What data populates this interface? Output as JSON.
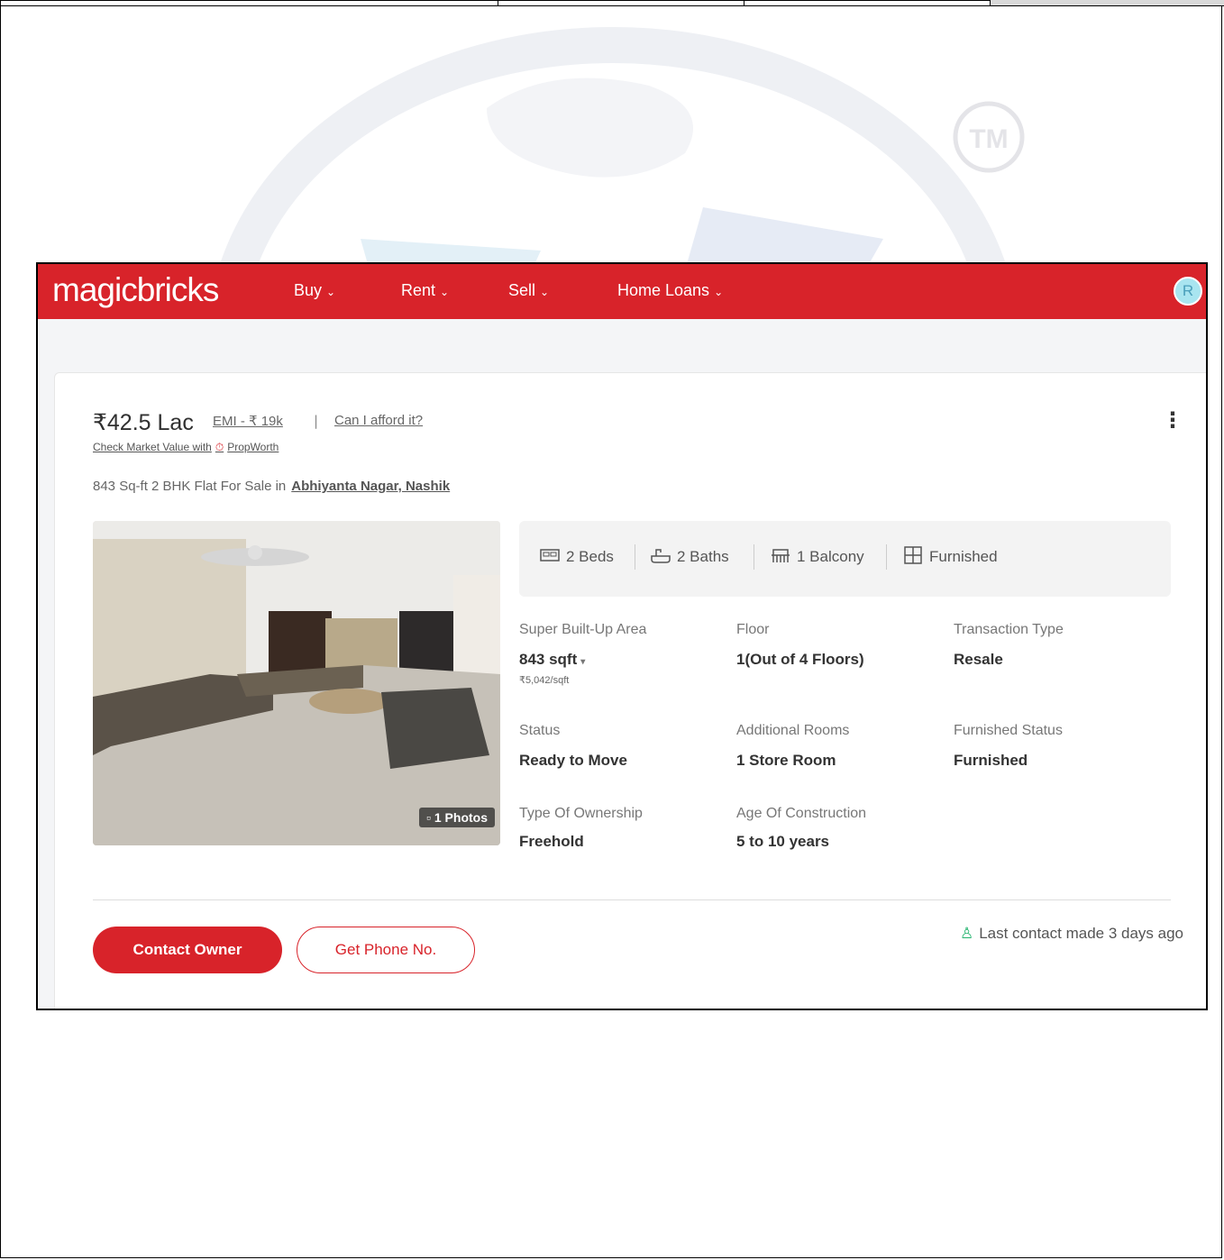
{
  "nav": {
    "logo": "magicbricks",
    "items": [
      {
        "label": "Buy"
      },
      {
        "label": "Rent"
      },
      {
        "label": "Sell"
      },
      {
        "label": "Home Loans"
      }
    ],
    "avatar_initial": "R",
    "brand_color": "#d8232a"
  },
  "watermark": {
    "tm": "TM"
  },
  "listing": {
    "price": "₹42.5 Lac",
    "emi": "EMI - ₹ 19k",
    "separator": "|",
    "afford": "Can I afford it?",
    "market_value": "Check Market Value with",
    "propworth": "PropWorth",
    "more_icon": "⋮",
    "subtitle": "843 Sq-ft 2 BHK Flat For Sale in",
    "location": "Abhiyanta Nagar, Nashik",
    "photo_count": "1 Photos",
    "amenities": [
      {
        "label": "2 Beds",
        "icon": "bed-icon"
      },
      {
        "label": "2 Baths",
        "icon": "bath-icon"
      },
      {
        "label": "1 Balcony",
        "icon": "balcony-icon"
      },
      {
        "label": "Furnished",
        "icon": "furnished-icon"
      }
    ],
    "details": [
      {
        "label": "Super Built-Up Area",
        "value": "843 sqft",
        "sub": "₹5,042/sqft"
      },
      {
        "label": "Floor",
        "value": "1(Out of 4 Floors)"
      },
      {
        "label": "Transaction Type",
        "value": "Resale"
      },
      {
        "label": "Status",
        "value": "Ready to Move"
      },
      {
        "label": "Additional Rooms",
        "value": "1 Store Room"
      },
      {
        "label": "Furnished Status",
        "value": "Furnished"
      },
      {
        "label": "Type Of Ownership",
        "value": "Freehold"
      },
      {
        "label": "Age Of Construction",
        "value": "5 to 10 years"
      }
    ],
    "contact_owner": "Contact Owner",
    "get_phone": "Get Phone No.",
    "last_contact": "Last contact made 3 days ago"
  }
}
